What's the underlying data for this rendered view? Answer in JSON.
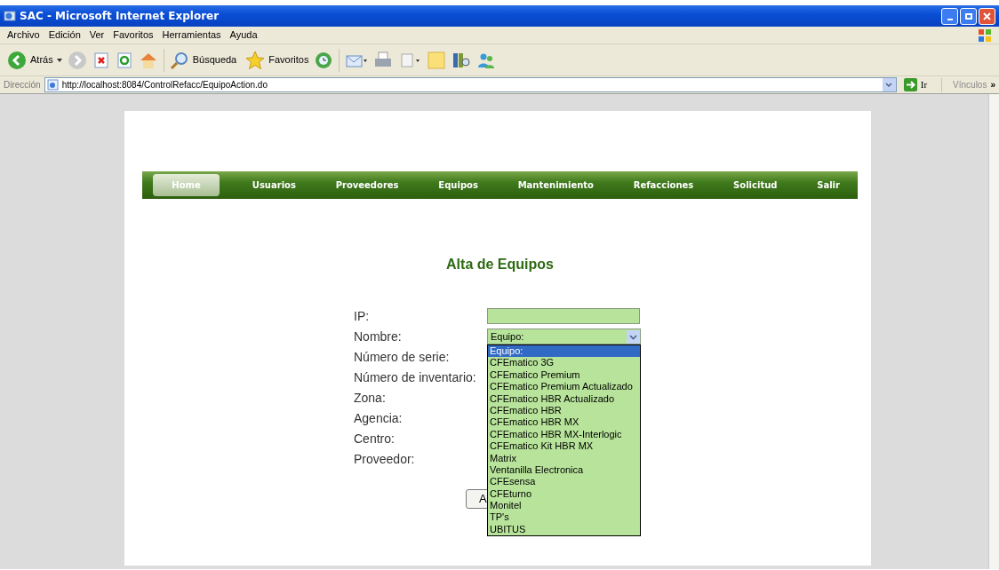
{
  "window": {
    "title": "SAC - Microsoft Internet Explorer"
  },
  "menu": [
    "Archivo",
    "Edición",
    "Ver",
    "Favoritos",
    "Herramientas",
    "Ayuda"
  ],
  "toolbar": {
    "back_label": "Atrás",
    "search_label": "Búsqueda",
    "favorites_label": "Favoritos"
  },
  "address_bar": {
    "label": "Dirección",
    "url": "http://localhost:8084/ControlRefacc/EquipoAction.do",
    "go_label": "Ir",
    "links_label": "Vínculos",
    "overflow": "»"
  },
  "nav": [
    {
      "label": "Home",
      "selected": true
    },
    {
      "label": "Usuarios",
      "selected": false
    },
    {
      "label": "Proveedores",
      "selected": false
    },
    {
      "label": "Equipos",
      "selected": false
    },
    {
      "label": "Mantenimiento",
      "selected": false
    },
    {
      "label": "Refacciones",
      "selected": false
    },
    {
      "label": "Solicitud",
      "selected": false
    },
    {
      "label": "Salir",
      "selected": false
    }
  ],
  "form": {
    "title": "Alta de Equipos",
    "fields": [
      {
        "label": "IP:",
        "kind": "input"
      },
      {
        "label": "Nombre:",
        "kind": "select",
        "value": "Equipo:"
      },
      {
        "label": "Número de serie:",
        "kind": "none"
      },
      {
        "label": "Número de inventario:",
        "kind": "none"
      },
      {
        "label": "Zona:",
        "kind": "none"
      },
      {
        "label": "Agencia:",
        "kind": "none"
      },
      {
        "label": "Centro:",
        "kind": "none"
      },
      {
        "label": "Proveedor:",
        "kind": "none"
      }
    ],
    "submit_label": "A",
    "dropdown": [
      {
        "label": "Equipo:",
        "selected": true
      },
      {
        "label": "CFEmatico 3G",
        "selected": false
      },
      {
        "label": "CFEmatico Premium",
        "selected": false
      },
      {
        "label": "CFEmatico Premium Actualizado",
        "selected": false
      },
      {
        "label": "CFEmatico HBR Actualizado",
        "selected": false
      },
      {
        "label": "CFEmatico HBR",
        "selected": false
      },
      {
        "label": "CFEmatico HBR MX",
        "selected": false
      },
      {
        "label": "CFEmatico HBR MX-Interlogic",
        "selected": false
      },
      {
        "label": "CFEmatico Kit HBR MX",
        "selected": false
      },
      {
        "label": "Matrix",
        "selected": false
      },
      {
        "label": "Ventanilla Electronica",
        "selected": false
      },
      {
        "label": "CFEsensa",
        "selected": false
      },
      {
        "label": "CFEturno",
        "selected": false
      },
      {
        "label": "Monitel",
        "selected": false
      },
      {
        "label": "TP's",
        "selected": false
      },
      {
        "label": "UBITUS",
        "selected": false
      }
    ]
  }
}
